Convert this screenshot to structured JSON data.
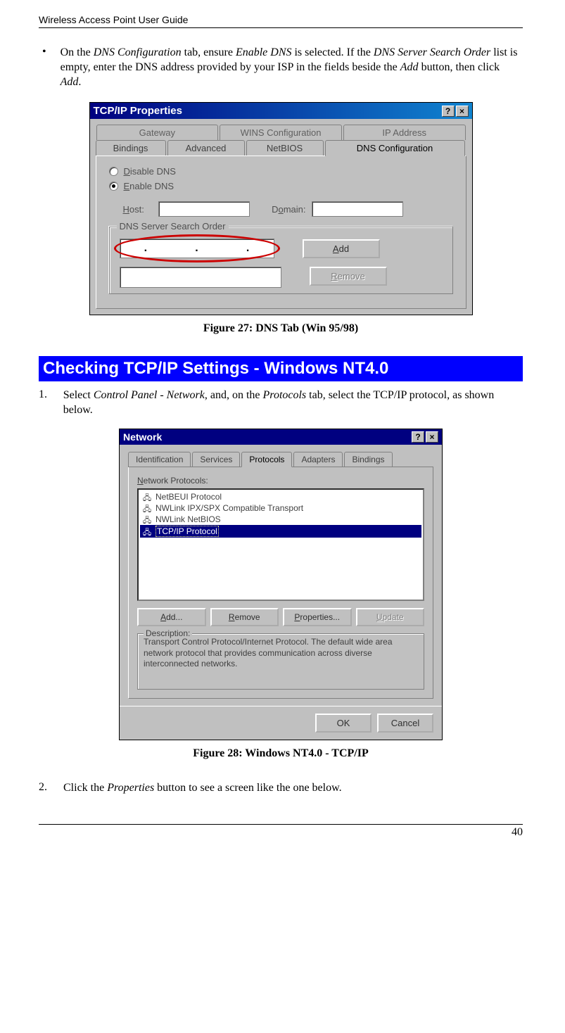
{
  "header": {
    "title": "Wireless Access Point User Guide"
  },
  "bullet1": {
    "text_parts": {
      "p1a": "On the ",
      "p1b": "DNS Configuration",
      "p1c": " tab, ensure ",
      "p1d": "Enable DNS",
      "p1e": " is selected. If the ",
      "p1f": "DNS Server Search Order",
      "p1g": " list is empty, enter the DNS address provided by your ISP in the fields beside the ",
      "p1h": "Add",
      "p1i": " button, then click ",
      "p1j": "Add",
      "p1k": "."
    }
  },
  "fig27": {
    "title": "TCP/IP Properties",
    "help_btn": "?",
    "close_btn": "×",
    "tabs_back": [
      "Gateway",
      "WINS Configuration",
      "IP Address"
    ],
    "tabs_front": [
      "Bindings",
      "Advanced",
      "NetBIOS",
      "DNS Configuration"
    ],
    "selected_tab_index": 3,
    "radio_disable": "Disable DNS",
    "radio_disable_ul": "D",
    "radio_enable": "Enable DNS",
    "radio_enable_ul": "E",
    "host_label": "Host:",
    "host_ul": "H",
    "domain_label": "Domain:",
    "domain_ul": "o",
    "group_label": "DNS Server Search Order",
    "ip_dots": [
      ".",
      ".",
      "."
    ],
    "btn_add": "Add",
    "btn_add_ul": "A",
    "btn_remove": "Remove",
    "btn_remove_ul": "R",
    "caption": "Figure 27: DNS Tab (Win 95/98)"
  },
  "section2": {
    "heading": "Checking TCP/IP Settings - Windows NT4.0"
  },
  "step1": {
    "num": "1.",
    "a": "Select ",
    "b": "Control Panel - Network",
    "c": ", and, on the ",
    "d": "Protocols",
    "e": " tab, select the TCP/IP protocol, as shown below."
  },
  "fig28": {
    "title": "Network",
    "help_btn": "?",
    "close_btn": "×",
    "tabs": [
      "Identification",
      "Services",
      "Protocols",
      "Adapters",
      "Bindings"
    ],
    "selected_tab_index": 2,
    "list_label": "Network Protocols:",
    "list_label_ul": "N",
    "items": [
      "NetBEUI Protocol",
      "NWLink IPX/SPX Compatible Transport",
      "NWLink NetBIOS",
      "TCP/IP Protocol"
    ],
    "selected_item_index": 3,
    "btn_add": "Add...",
    "btn_remove": "Remove",
    "btn_properties": "Properties...",
    "btn_update": "Update",
    "desc_label": "Description:",
    "desc_text": "Transport Control Protocol/Internet Protocol. The default wide area network protocol that provides communication across diverse interconnected networks.",
    "btn_ok": "OK",
    "btn_cancel": "Cancel",
    "caption": "Figure 28: Windows NT4.0 - TCP/IP"
  },
  "step2": {
    "num": "2.",
    "a": "Click the ",
    "b": "Properties",
    "c": " button to see a screen like the one below."
  },
  "page": {
    "number": "40"
  }
}
